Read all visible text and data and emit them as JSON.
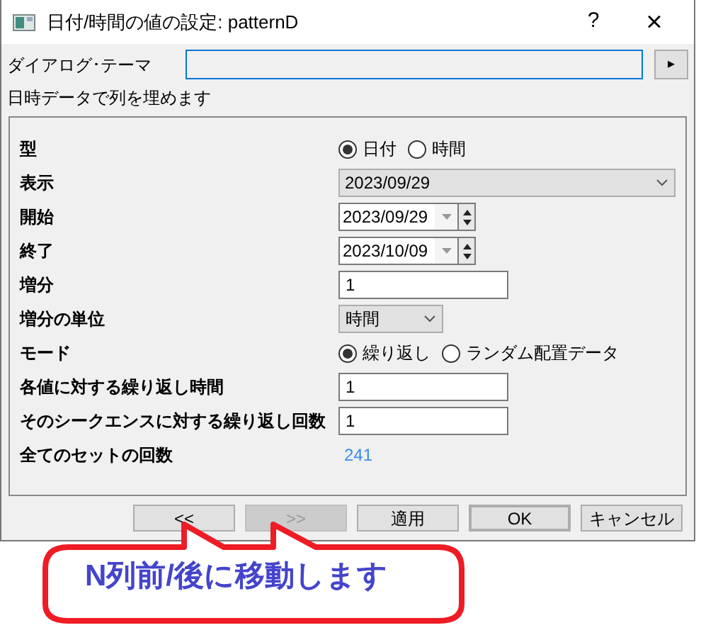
{
  "window": {
    "title": "日付/時間の値の設定: patternD",
    "help": "?",
    "close": "×"
  },
  "theme": {
    "label": "ダイアログ･テーマ",
    "button": "▸"
  },
  "description": "日時データで列を埋めます",
  "fields": [
    {
      "kind": "radio",
      "label": "型",
      "options": [
        {
          "label": "日付",
          "selected": true
        },
        {
          "label": "時間",
          "selected": false
        }
      ]
    },
    {
      "kind": "dropdown",
      "label": "表示",
      "value": "2023/09/29",
      "wide": true
    },
    {
      "kind": "date",
      "label": "開始",
      "value": "2023/09/29"
    },
    {
      "kind": "date",
      "label": "終了",
      "value": "2023/10/09"
    },
    {
      "kind": "text",
      "label": "増分",
      "value": "1"
    },
    {
      "kind": "dropdown",
      "label": "増分の単位",
      "value": "時間",
      "wide": false
    },
    {
      "kind": "radio",
      "label": "モード",
      "options": [
        {
          "label": "繰り返し",
          "selected": true
        },
        {
          "label": "ランダム配置データ",
          "selected": false
        }
      ]
    },
    {
      "kind": "text",
      "label": "各値に対する繰り返し時間",
      "value": "1"
    },
    {
      "kind": "text",
      "label": "そのシークエンスに対する繰り返し回数",
      "value": "1"
    },
    {
      "kind": "readout",
      "label": "全てのセットの回数",
      "value": "241"
    }
  ],
  "buttons": [
    {
      "label": "<<",
      "disabled": false,
      "default": false
    },
    {
      "label": ">>",
      "disabled": true,
      "default": false
    },
    {
      "label": "適用",
      "disabled": false,
      "default": false
    },
    {
      "label": "OK",
      "disabled": false,
      "default": true
    },
    {
      "label": "キャンセル",
      "disabled": false,
      "default": false
    }
  ],
  "callout": "N列前/後に移動します"
}
